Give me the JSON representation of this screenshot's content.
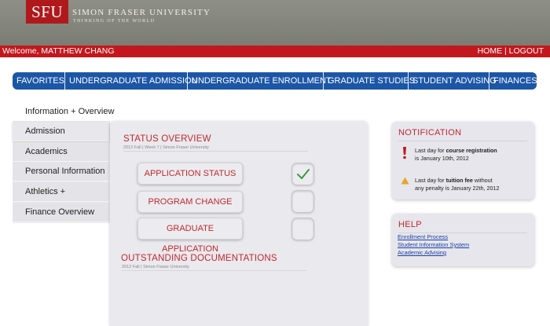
{
  "header": {
    "logo": "SFU",
    "university_name": "SIMON FRASER UNIVERSITY",
    "tagline": "THINKING OF THE WORLD"
  },
  "welcome_bar": {
    "welcome": "Welcome, MATTHEW CHANG",
    "home": "HOME",
    "separator": "|",
    "logout": "LOGOUT"
  },
  "nav": [
    "FAVORITES",
    "UNDERGRADUATE ADMISSION",
    "UNDERGRADUATE ENROLLMENT",
    "GRADUATE STUDIES",
    "STUDENT ADVISING",
    "FINANCES"
  ],
  "sidebar": {
    "items": [
      "Information + Overview",
      "Admission",
      "Academics",
      "Personal Information",
      "Athletics + Recreation",
      "Finance Overview"
    ]
  },
  "status_overview": {
    "title": "STATUS OVERVIEW",
    "subtitle": "2012 Fall | Week 7 | Simon Fraser University",
    "buttons": [
      {
        "label": "APPLICATION STATUS",
        "checked": true
      },
      {
        "label": "PROGRAM CHANGE",
        "checked": false
      },
      {
        "label": "GRADUATE APPLICATION",
        "checked": false
      }
    ]
  },
  "outstanding": {
    "title": "OUTSTANDING DOCUMENTATIONS",
    "subtitle": "2012 Fall | Simon Fraser University"
  },
  "notification": {
    "title": "NOTIFICATION",
    "items": [
      {
        "pre": "Last day for ",
        "bold": "course registration",
        "post": "is January 10th, 2012",
        "icon": "exclamation-icon"
      },
      {
        "pre": "Last day for ",
        "bold": "tuition fee",
        "mid": " without",
        "post": "any penalty is January 22th, 2012",
        "icon": "warning-icon"
      }
    ]
  },
  "help": {
    "title": "HELP",
    "links": [
      "Enrollment Process",
      "Student Information System",
      "Academic Advising"
    ]
  },
  "colors": {
    "brand_red": "#c2181d",
    "nav_blue": "#1c56a6",
    "header_gray": "#8e8f86",
    "check_green": "#3a9a3e",
    "warning_yellow": "#e3a92a"
  }
}
